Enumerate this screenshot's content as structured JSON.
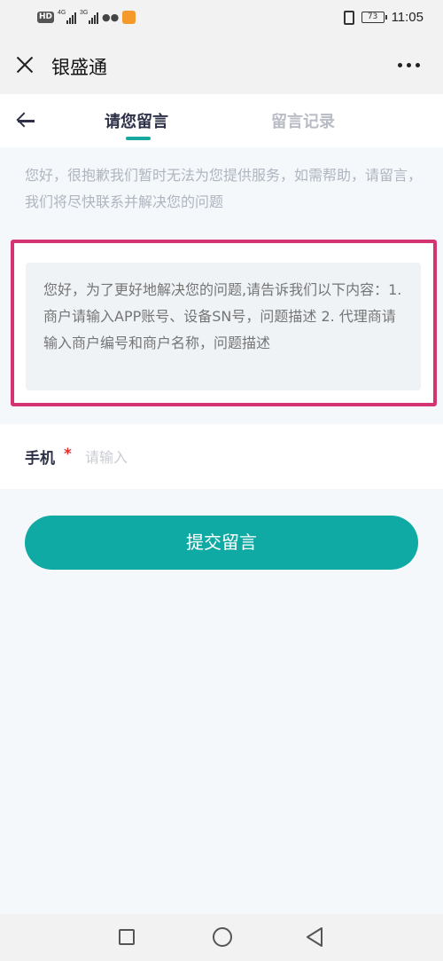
{
  "status_bar": {
    "hd_label": "HD",
    "network_1": "4G",
    "network_2": "3G",
    "battery": "73",
    "time": "11:05"
  },
  "title_bar": {
    "app_title": "银盛通"
  },
  "tabs": [
    {
      "label": "请您留言",
      "active": true
    },
    {
      "label": "留言记录",
      "active": false
    }
  ],
  "notice_text": "您好，很抱歉我们暂时无法为您提供服务，如需帮助，请留言，我们将尽快联系并解决您的问题",
  "message": {
    "placeholder": "您好，为了更好地解决您的问题,请告诉我们以下内容：1. 商户请输入APP账号、设备SN号，问题描述 2. 代理商请输入商户编号和商户名称，问题描述"
  },
  "phone_field": {
    "label": "手机",
    "required_mark": "*",
    "placeholder": "请输入"
  },
  "submit_label": "提交留言",
  "colors": {
    "accent": "#10aaa5",
    "highlight_border": "#d43572",
    "required": "#e02d2d"
  }
}
